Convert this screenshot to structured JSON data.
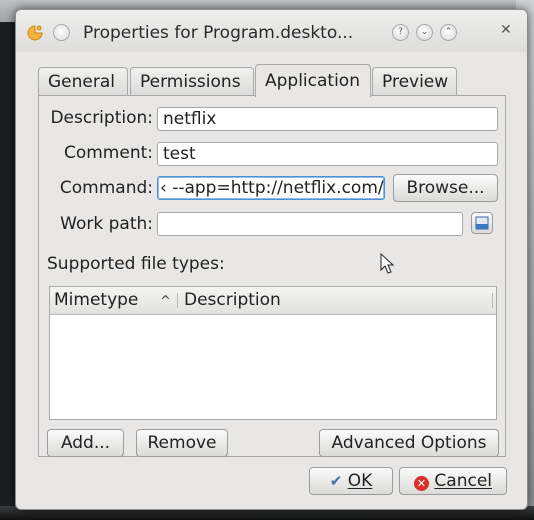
{
  "window": {
    "title": "Properties for Program.deskto...",
    "controls": [
      "help-icon",
      "minimize-icon",
      "maximize-icon",
      "close-icon"
    ]
  },
  "tabs": [
    {
      "label": "General",
      "active": false
    },
    {
      "label": "Permissions",
      "active": false
    },
    {
      "label": "Application",
      "active": true
    },
    {
      "label": "Preview",
      "active": false
    }
  ],
  "form": {
    "description_label": "Description:",
    "description_value": "netflix",
    "comment_label": "Comment:",
    "comment_value": "test",
    "command_label": "Command:",
    "command_value": "‹ --app=http://netflix.com/",
    "browse_label": "Browse...",
    "workpath_label": "Work path:",
    "workpath_value": ""
  },
  "filetypes": {
    "section_label": "Supported file types:",
    "columns": [
      "Mimetype",
      "Description"
    ],
    "sort_indicator": "^",
    "rows": []
  },
  "buttons": {
    "add": "Add...",
    "remove": "Remove",
    "advanced": "Advanced Options",
    "ok": "OK",
    "cancel": "Cancel"
  },
  "colors": {
    "accent_focus": "#4f8fd6",
    "cancel_icon": "#d9302c",
    "ok_icon": "#3b6fb0"
  }
}
